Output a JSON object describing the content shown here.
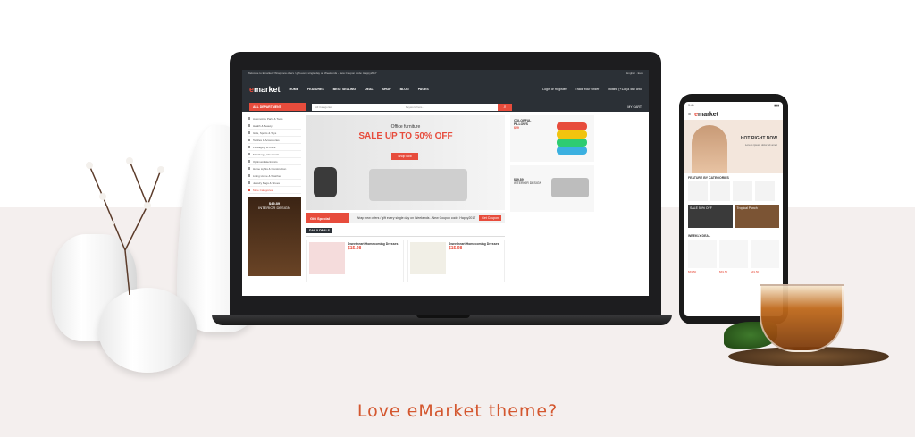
{
  "tagline": "Love eMarket theme?",
  "laptop_site": {
    "topbar_text": "Welcome to Emarket ! Wrap new offers / gift every single day on Weekends - New Coupon code: Happy2017",
    "topbar_right": "English · Euro",
    "logo": "market",
    "nav": [
      "HOME",
      "FEATURES",
      "BEST SELLING",
      "DEAL",
      "SHOP",
      "BLOG",
      "PAGES"
    ],
    "login": "Login or Register",
    "track": "Track Your Order",
    "hotline": "Hotline (+123)4 567 890",
    "all_department": "ALL DEPARTMENT",
    "search_placeholder": "Keyword here...",
    "search_category": "All Categories",
    "cart": "MY CART",
    "sidebar_items": [
      "Automotive Parts & Tools",
      "Health & Beauty",
      "Gifts, Sports & Toys",
      "Textiles & Accessories",
      "Packaging & Office",
      "Metallurgy, Chemicals",
      "Optimum Electronics",
      "Home Lights & Construction",
      "Living Home & Watches",
      "Jewelry Bags & Shoes",
      "More Categories"
    ],
    "side_promo_price": "$49.89",
    "side_promo_label": "INTERIOR DESIGN",
    "banner_title": "Office furniture",
    "banner_sale": "SALE UP TO 50% OFF",
    "banner_button": "Shop now",
    "gift_tag": "Gift Special",
    "gift_text": "Wrap new offers / gift every single day on Weekends - New Coupon code: Happy2017",
    "gift_button": "Get Coupon",
    "daily_deals": "DAILY DEALS",
    "deals": [
      {
        "title": "Sweetheart Homecoming Dresses",
        "price": "$15.98",
        "old": "$20.00"
      },
      {
        "title": "Sweetheart Homecoming Dresses",
        "price": "$15.98",
        "old": "$20.00"
      }
    ],
    "promo1_title": "COLORFUL PILLOWS",
    "promo1_price": "$29",
    "promo2_price": "$49.89",
    "promo2_title": "INTERIOR DESIGN"
  },
  "phone_site": {
    "time": "9:41",
    "logo": "market",
    "hero_title": "HOT RIGHT NOW",
    "hero_sub": "Lorem ipsum dolor sit amet",
    "featured": "FEATURE BY CATEGORIES",
    "banner1": "SALE 50% OFF",
    "banner2": "Tropical Punch",
    "weekly": "WEEKLY DEAL",
    "prices": [
      "$69.50",
      "$69.50",
      "$49.50"
    ]
  },
  "colors": {
    "accent": "#e74c3c",
    "tagline": "#d4572f",
    "dark": "#2b3036"
  }
}
